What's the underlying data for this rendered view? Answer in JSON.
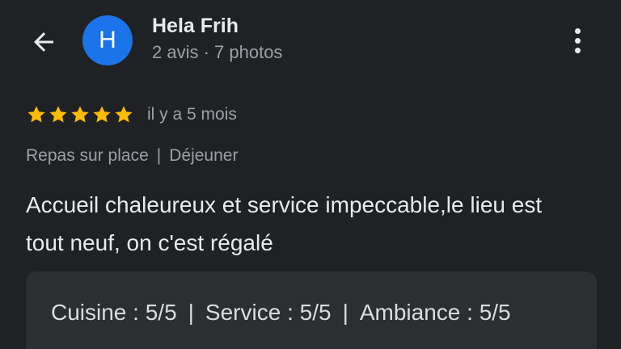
{
  "header": {
    "author_initial": "H",
    "author_name": "Hela Frih",
    "author_meta": "2 avis · 7 photos"
  },
  "review": {
    "stars": 5,
    "star_color": "#fbbc04",
    "date": "il y a 5 mois",
    "tags": [
      "Repas sur place",
      "Déjeuner"
    ],
    "tag_separator": "|",
    "text_line1": "Accueil chaleureux et service impeccable,le lieu est",
    "text_line2": "tout neuf, on c'est régalé"
  },
  "sub_ratings": {
    "separator": "|",
    "items": [
      {
        "label": "Cuisine : 5/5"
      },
      {
        "label": "Service : 5/5"
      },
      {
        "label": "Ambiance : 5/5"
      }
    ]
  },
  "colors": {
    "background": "#202124",
    "avatar": "#1a73e8",
    "card": "#2d2e31",
    "secondary_text": "#9aa0a6"
  },
  "icons": {
    "back": "arrow-left-icon",
    "more": "more-vert-icon",
    "star": "star-icon"
  }
}
